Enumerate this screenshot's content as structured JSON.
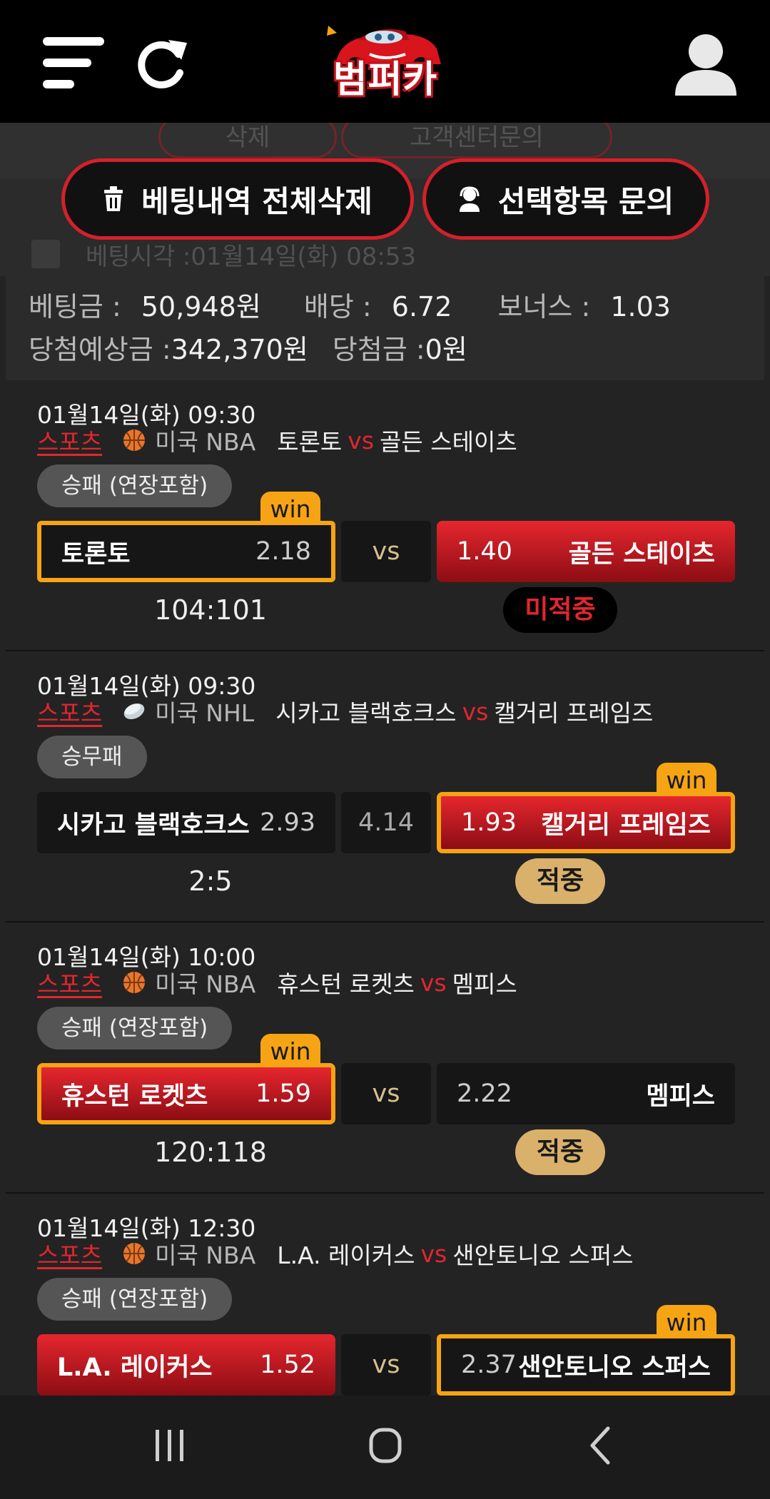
{
  "header": {
    "menu_icon": "hamburger-menu-icon",
    "refresh_icon": "refresh-icon",
    "logo_text": "범퍼카",
    "user_icon": "user-icon"
  },
  "ghost": {
    "btn1": "삭제",
    "btn2": "고객센터문의",
    "bet_time": "베팅시각 :01월14일(화) 08:53"
  },
  "actions": {
    "delete_all": "베팅내역 전체삭제",
    "inquiry": "선택항목 문의"
  },
  "summary": {
    "bet_label": "베팅금 :",
    "bet_value": "50,948원",
    "odds_label": "배당 :",
    "odds_value": "6.72",
    "bonus_label": "보너스 :",
    "bonus_value": "1.03",
    "expected_label": "당첨예상금 :",
    "expected_value": "342,370원",
    "won_label": "당첨금 :",
    "won_value": "0원"
  },
  "bets": [
    {
      "datetime": "01월14일(화) 09:30",
      "sport": "스포츠",
      "league": "미국 NBA",
      "home": "토론토",
      "vs": "vs",
      "away": "골든 스테이츠",
      "market": "승패 (연장포함)",
      "left_team": "토론토",
      "left_odd": "2.18",
      "mid": "vs",
      "right_odd": "1.40",
      "right_team": "골든 스테이츠",
      "win_label": "win",
      "score": "104:101",
      "result": "미적중"
    },
    {
      "datetime": "01월14일(화) 09:30",
      "sport": "스포츠",
      "league": "미국 NHL",
      "home": "시카고 블랙호크스",
      "vs": "vs",
      "away": "캘거리 프레임즈",
      "market": "승무패",
      "left_team": "시카고 블랙호크스",
      "left_odd": "2.93",
      "mid": "4.14",
      "right_odd": "1.93",
      "right_team": "캘거리 프레임즈",
      "win_label": "win",
      "score": "2:5",
      "result": "적중"
    },
    {
      "datetime": "01월14일(화) 10:00",
      "sport": "스포츠",
      "league": "미국 NBA",
      "home": "휴스턴 로켓츠",
      "vs": "vs",
      "away": "멤피스",
      "market": "승패 (연장포함)",
      "left_team": "휴스턴 로켓츠",
      "left_odd": "1.59",
      "mid": "vs",
      "right_odd": "2.22",
      "right_team": "멤피스",
      "win_label": "win",
      "score": "120:118",
      "result": "적중"
    },
    {
      "datetime": "01월14일(화) 12:30",
      "sport": "스포츠",
      "league": "미국 NBA",
      "home": "L.A. 레이커스",
      "vs": "vs",
      "away": "샌안토니오 스퍼스",
      "market": "승패 (연장포함)",
      "left_team": "L.A. 레이커스",
      "left_odd": "1.52",
      "mid": "vs",
      "right_odd": "2.37",
      "right_team": "샌안토니오 스퍼스",
      "win_label": "win"
    }
  ],
  "colors": {
    "accent_red": "#d4202a",
    "win_orange": "#f6a414",
    "hit_gold": "#d9b16b"
  }
}
